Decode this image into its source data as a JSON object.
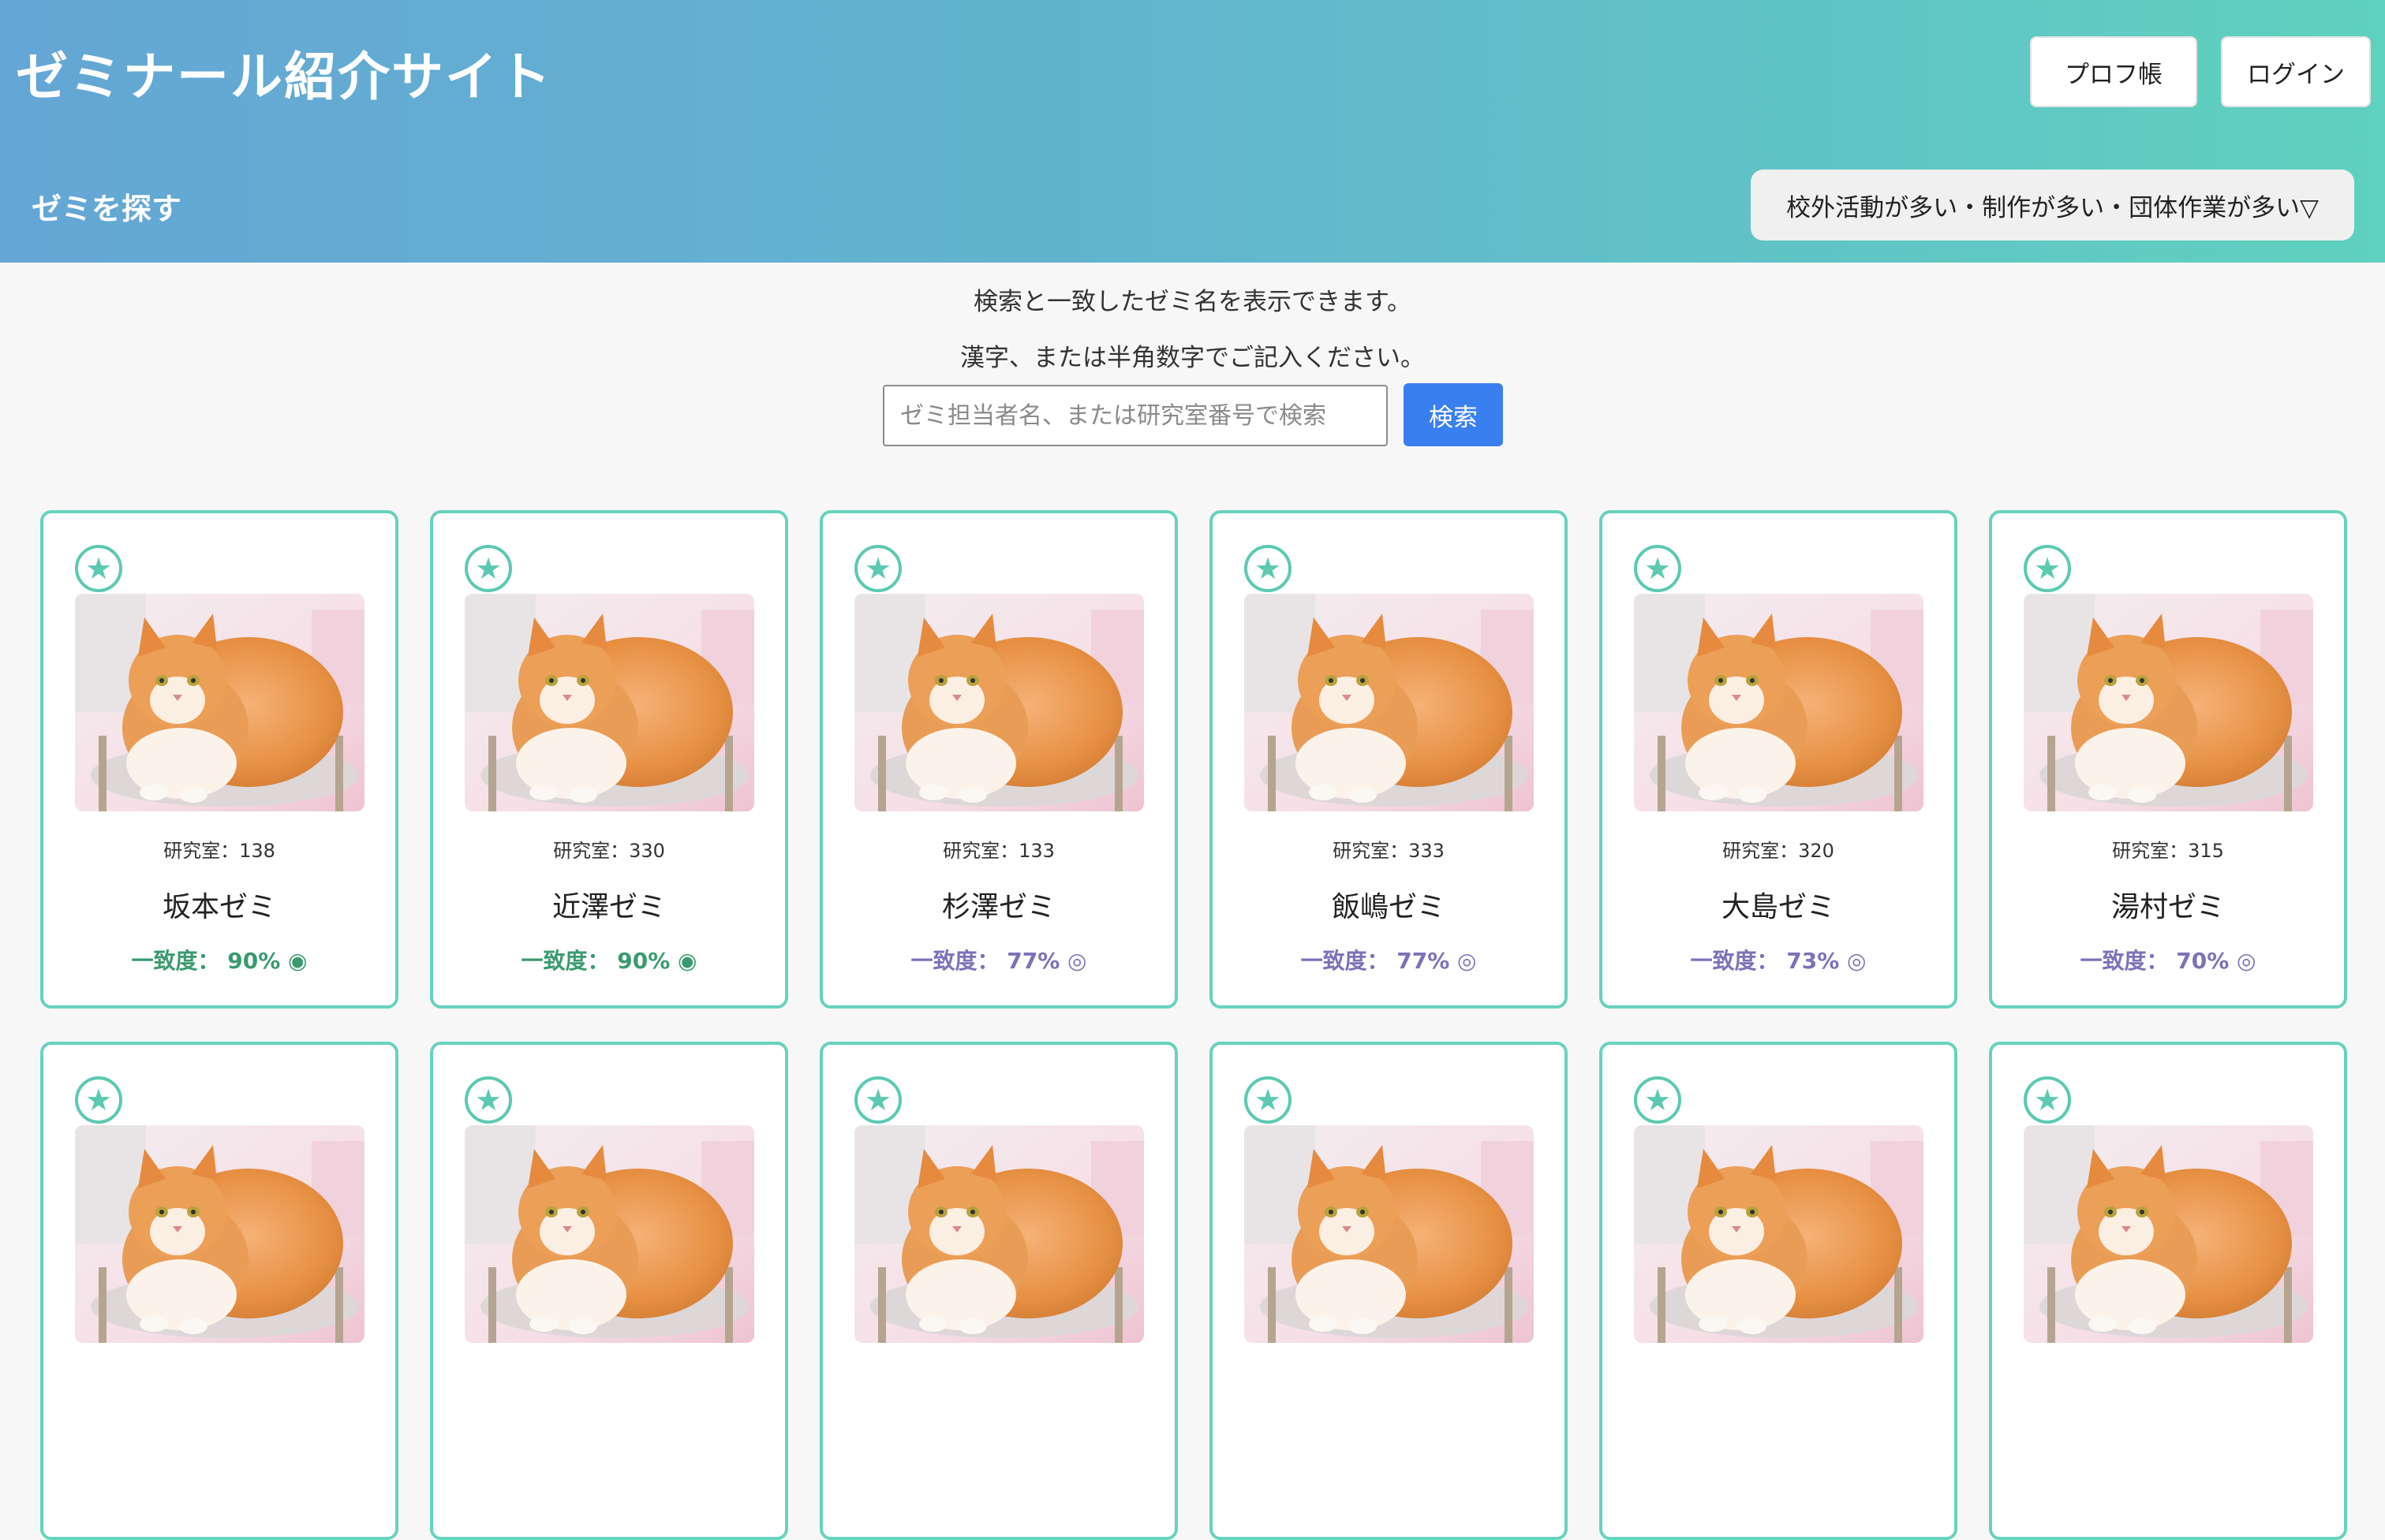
{
  "header": {
    "site_title": "ゼミナール紹介サイト",
    "profile_button": "プロフ帳",
    "login_button": "ログイン",
    "search_zemi_label": "ゼミを探す",
    "filter_dropdown": "校外活動が多い・制作が多い・団体作業が多い▽"
  },
  "search": {
    "description_line1": "検索と一致したゼミ名を表示できます。",
    "description_line2": "漢字、または半角数字でご記入ください。",
    "placeholder": "ゼミ担当者名、または研究室番号で検索",
    "button": "検索"
  },
  "colors": {
    "header_gradient_start": "#64a6d5",
    "header_gradient_end": "#5fd1bf",
    "card_border": "#67d2be",
    "match_high": "#3a9a6e",
    "match_mid": "#7b72b8",
    "search_button": "#3a7ff0"
  },
  "cards": [
    {
      "room": "研究室：138",
      "name": "坂本ゼミ",
      "match": "一致度： 90% ◉",
      "level": "high"
    },
    {
      "room": "研究室：330",
      "name": "近澤ゼミ",
      "match": "一致度： 90% ◉",
      "level": "high"
    },
    {
      "room": "研究室：133",
      "name": "杉澤ゼミ",
      "match": "一致度： 77% ◎",
      "level": "mid"
    },
    {
      "room": "研究室：333",
      "name": "飯嶋ゼミ",
      "match": "一致度： 77% ◎",
      "level": "mid"
    },
    {
      "room": "研究室：320",
      "name": "大島ゼミ",
      "match": "一致度： 73% ◎",
      "level": "mid"
    },
    {
      "room": "研究室：315",
      "name": "湯村ゼミ",
      "match": "一致度： 70% ◎",
      "level": "mid"
    },
    {
      "room": "",
      "name": "",
      "match": "",
      "level": "mid"
    },
    {
      "room": "",
      "name": "",
      "match": "",
      "level": "mid"
    },
    {
      "room": "",
      "name": "",
      "match": "",
      "level": "mid"
    },
    {
      "room": "",
      "name": "",
      "match": "",
      "level": "mid"
    },
    {
      "room": "",
      "name": "",
      "match": "",
      "level": "mid"
    },
    {
      "room": "",
      "name": "",
      "match": "",
      "level": "mid"
    }
  ],
  "card_icons": {
    "favorite": "star-icon",
    "photo": "cat-photo"
  }
}
